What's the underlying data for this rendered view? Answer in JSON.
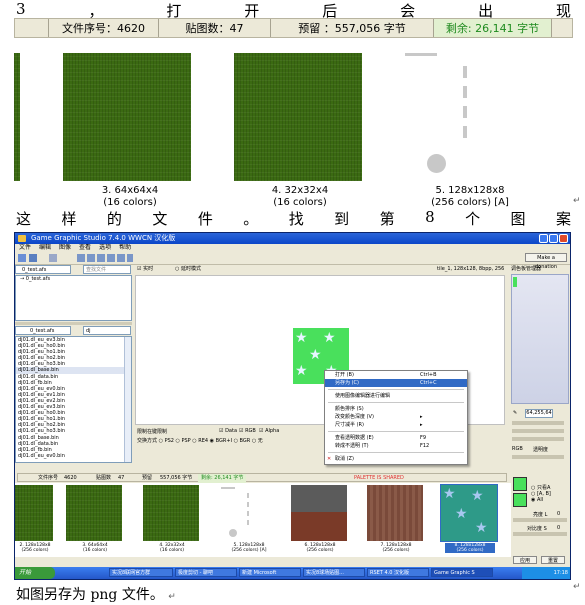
{
  "doc": {
    "line1": [
      "3",
      "，",
      "打",
      "开",
      "后",
      "会",
      "出",
      "现"
    ],
    "line2": [
      "这",
      "样",
      "的",
      "文",
      "件",
      "。",
      "找",
      "到",
      "第",
      "8",
      "个",
      "图",
      "案"
    ],
    "line3": "如图另存为 png 文件。",
    "return_mark": "↵"
  },
  "top_status": {
    "file_index": "文件序号：4620",
    "tile_count": "贴图数：47",
    "reserved": "预留 ：557,056 字节",
    "remaining": "剩余: 26,141 字节"
  },
  "top_thumbs": [
    {
      "label": "3. 64x64x4",
      "colors": "(16 colors)"
    },
    {
      "label": "4. 32x32x4",
      "colors": "(16 colors)"
    },
    {
      "label": "5. 128x128x8",
      "colors": "(256 colors) [A]"
    }
  ],
  "app": {
    "title": "Game Graphic Studio 7.4.0 WWCN 汉化版",
    "menu": [
      "文件",
      "编辑",
      "图像",
      "查看",
      "选项",
      "帮助"
    ],
    "donate": "Make a donation",
    "left_top_tab": "0_test.afs",
    "search_placeholder": "查找文件",
    "left_tree_item": "0_test.afs",
    "left_mid_tab": "0_test.afs",
    "left_mid_input": "dj",
    "file_list": [
      "dj01.dl_eu_ev3.bin",
      "dj01.dl_eu_ho0.bin",
      "dj01.dl_eu_ho1.bin",
      "dj01.dl_eu_ho2.bin",
      "dj01.dl_eu_ho3.bin",
      "dj01.dl_base.bin",
      "dj01.dl_data.bin",
      "dj01.dl_fb.bin",
      "dj01.dl_eu_ev0.bin",
      "dj01.dl_eu_ev1.bin",
      "dj01.dl_eu_ev2.bin",
      "dj01.dl_eu_ev3.bin",
      "dj01.dl_eu_ho0.bin",
      "dj01.dl_eu_ho1.bin",
      "dj01.dl_eu_ho2.bin",
      "dj01.dl_eu_ho3.bin",
      "dj01.dl_base.bin",
      "dj01.dl_data.bin",
      "dj01.dl_fb.bin",
      "dj01.dl_eu_ev0.bin"
    ],
    "realtime": "实时",
    "delay_mode": "延时模式",
    "tile_info": "tile_1, 128x128, 8bpp, 256 colors",
    "palette_manager": "调色板管理器",
    "ctx_menu": [
      {
        "label": "打开 (B)",
        "shortcut": "Ctrl+B"
      },
      {
        "label": "另存为 (C)",
        "shortcut": "Ctrl+C"
      },
      {
        "label": "使用图像编辑器进行编辑",
        "shortcut": ""
      },
      {
        "label": "颜色排序 (S)",
        "shortcut": ""
      },
      {
        "label": "改变颜色深度 (V)",
        "shortcut": ""
      },
      {
        "label": "尺寸减半 (R)",
        "shortcut": ""
      },
      {
        "label": "查看透明数据 (E)",
        "shortcut": "F9"
      },
      {
        "label": "转成不透明 (T)",
        "shortcut": "F12"
      },
      {
        "label": "取消 (Z)",
        "shortcut": ""
      }
    ],
    "opts_heading": "限制在键限制",
    "check_data": "Data",
    "check_rgb": "RGB",
    "check_alpha": "Alpha",
    "format_label": "交换方式",
    "formats": [
      "PS2",
      "PSP",
      "RE4",
      "BGR+I",
      "BGR",
      "无"
    ],
    "status": {
      "file_index_label": "文件序号",
      "file_index": "4620",
      "tile_count_label": "贴图数",
      "tile_count": "47",
      "reserved_label": "预留",
      "reserved": "557,056 字节",
      "remaining": "剩余: 26,141 字节",
      "palette_shared": "PALETTE IS SHARED"
    },
    "bottom_thumbs": [
      {
        "label": "2. 128x128x8",
        "colors": "(256 colors)"
      },
      {
        "label": "3. 64x64x4",
        "colors": "(16 colors)"
      },
      {
        "label": "4. 32x32x4",
        "colors": "(16 colors)"
      },
      {
        "label": "5. 128x128x8",
        "colors": "(256 colors) [A]"
      },
      {
        "label": "6. 128x128x8",
        "colors": "(256 colors)"
      },
      {
        "label": "7. 128x128x8",
        "colors": "(256 colors)"
      },
      {
        "label": "8. 128x128x8",
        "colors": "(256 colors)"
      }
    ],
    "right_panel": {
      "hex_value": "64,255,64",
      "rgb_label": "RGB",
      "transparency_label": "透明度",
      "radio_a": "只看A",
      "radio_b": "[A, B]",
      "radio_all": "All",
      "brightness_label": "亮度 L",
      "brightness_value": "0",
      "contrast_label": "对比度 S",
      "contrast_value": "0",
      "apply": "应用",
      "reset": "重置"
    },
    "taskbar": {
      "start": "开始",
      "items": [
        "实况8联网官方群",
        "极度剪切 - 聊吧",
        "新建 Microsoft",
        "实况8球场贴图...",
        "RSET 4.0 汉化版",
        "Game Graphic S"
      ],
      "clock": "17:18"
    }
  },
  "colors": {
    "accent": "#316ac5",
    "texture_green": "#3b6a12",
    "status_green": "#1f8b1f",
    "bright_green": "#49e05c",
    "palette_red": "#e03030"
  }
}
